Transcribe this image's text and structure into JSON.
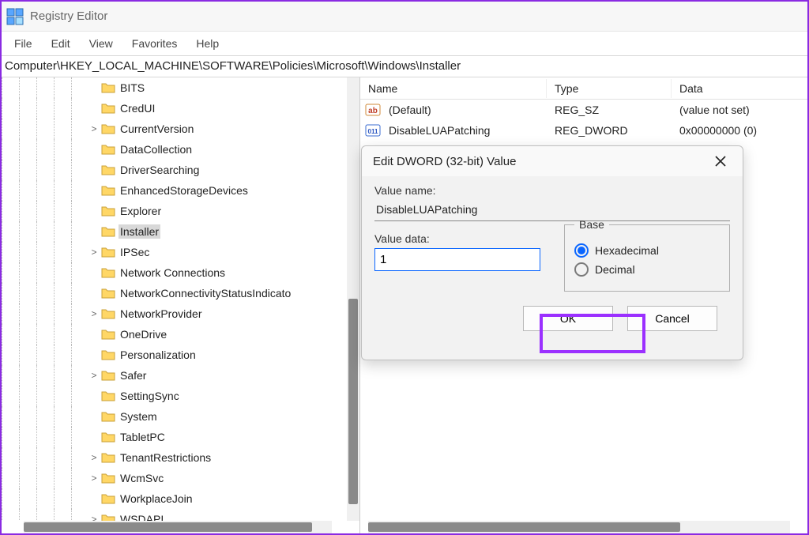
{
  "window": {
    "title": "Registry Editor"
  },
  "menu": {
    "file": "File",
    "edit": "Edit",
    "view": "View",
    "favorites": "Favorites",
    "help": "Help"
  },
  "address": "Computer\\HKEY_LOCAL_MACHINE\\SOFTWARE\\Policies\\Microsoft\\Windows\\Installer",
  "tree": [
    {
      "label": "BITS",
      "depth": 5,
      "expander": ""
    },
    {
      "label": "CredUI",
      "depth": 5,
      "expander": ""
    },
    {
      "label": "CurrentVersion",
      "depth": 5,
      "expander": ">"
    },
    {
      "label": "DataCollection",
      "depth": 5,
      "expander": ""
    },
    {
      "label": "DriverSearching",
      "depth": 5,
      "expander": ""
    },
    {
      "label": "EnhancedStorageDevices",
      "depth": 5,
      "expander": ""
    },
    {
      "label": "Explorer",
      "depth": 5,
      "expander": ""
    },
    {
      "label": "Installer",
      "depth": 5,
      "expander": "",
      "selected": true
    },
    {
      "label": "IPSec",
      "depth": 5,
      "expander": ">"
    },
    {
      "label": "Network Connections",
      "depth": 5,
      "expander": ""
    },
    {
      "label": "NetworkConnectivityStatusIndicato",
      "depth": 5,
      "expander": ""
    },
    {
      "label": "NetworkProvider",
      "depth": 5,
      "expander": ">"
    },
    {
      "label": "OneDrive",
      "depth": 5,
      "expander": ""
    },
    {
      "label": "Personalization",
      "depth": 5,
      "expander": ""
    },
    {
      "label": "Safer",
      "depth": 5,
      "expander": ">"
    },
    {
      "label": "SettingSync",
      "depth": 5,
      "expander": ""
    },
    {
      "label": "System",
      "depth": 5,
      "expander": ""
    },
    {
      "label": "TabletPC",
      "depth": 5,
      "expander": ""
    },
    {
      "label": "TenantRestrictions",
      "depth": 5,
      "expander": ">"
    },
    {
      "label": "WcmSvc",
      "depth": 5,
      "expander": ">"
    },
    {
      "label": "WorkplaceJoin",
      "depth": 5,
      "expander": ""
    },
    {
      "label": "WSDAPI",
      "depth": 5,
      "expander": ">"
    }
  ],
  "list": {
    "headers": {
      "name": "Name",
      "type": "Type",
      "data": "Data"
    },
    "rows": [
      {
        "icon": "string-value-icon",
        "name": "(Default)",
        "type": "REG_SZ",
        "data": "(value not set)"
      },
      {
        "icon": "dword-value-icon",
        "name": "DisableLUAPatching",
        "type": "REG_DWORD",
        "data": "0x00000000 (0)"
      }
    ]
  },
  "dialog": {
    "title": "Edit DWORD (32-bit) Value",
    "value_name_label": "Value name:",
    "value_name": "DisableLUAPatching",
    "value_data_label": "Value data:",
    "value_data": "1",
    "base_legend": "Base",
    "hex_label": "Hexadecimal",
    "dec_label": "Decimal",
    "ok": "OK",
    "cancel": "Cancel"
  }
}
